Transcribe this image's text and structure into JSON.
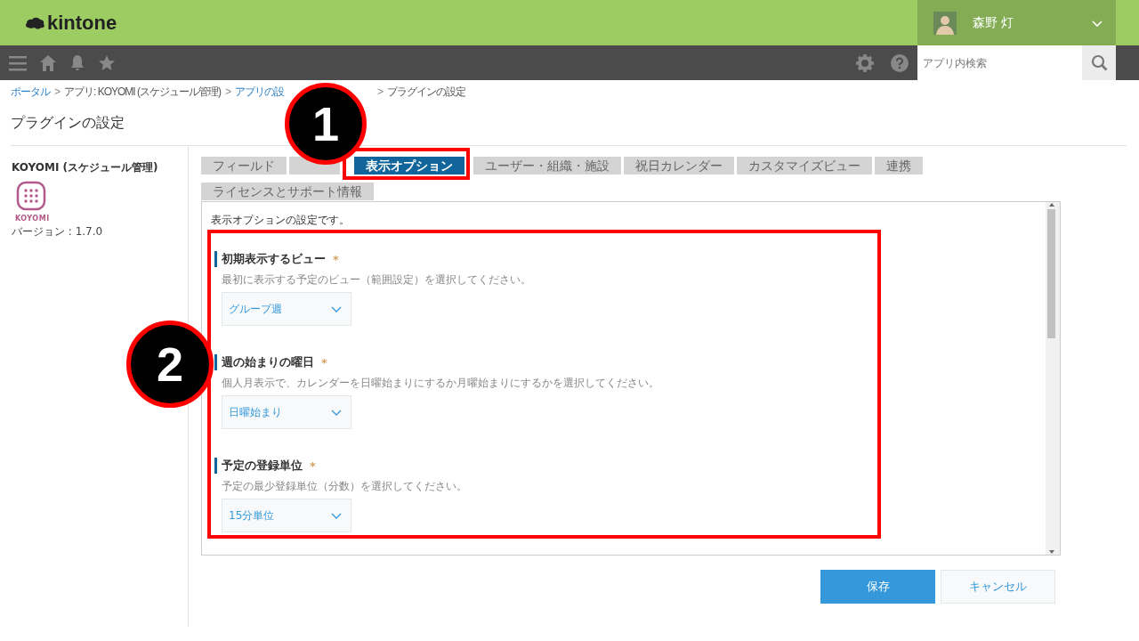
{
  "header": {
    "logo": "kintone",
    "user": {
      "name": "森野 灯"
    }
  },
  "navbar": {
    "search": {
      "placeholder": "アプリ内検索"
    }
  },
  "breadcrumb": [
    {
      "label": "ポータル",
      "kind": "link"
    },
    {
      "label": ">",
      "kind": "separator"
    },
    {
      "label": "アプリ: KOYOMI (スケジュール管理)",
      "kind": "text"
    },
    {
      "label": ">",
      "kind": "separator"
    },
    {
      "label": "アプリの設",
      "kind": "link"
    },
    {
      "label": ">",
      "kind": "separator"
    },
    {
      "label": "プラグインの設定",
      "kind": "text"
    }
  ],
  "page_title": "プラグインの設定",
  "plugin": {
    "name": "KOYOMI (スケジュール管理)",
    "icon_label": "KOYOMI",
    "version": "バージョン : 1.7.0"
  },
  "tabs": [
    {
      "label": "フィールド",
      "selected": false
    },
    {
      "selected": false
    },
    {
      "label": "表示オプション",
      "selected": true
    },
    {
      "label": "ユーザー・組織・施設",
      "selected": false
    },
    {
      "label": "祝日カレンダー",
      "selected": false
    },
    {
      "label": "カスタマイズビュー",
      "selected": false
    },
    {
      "label": "連携",
      "selected": false
    },
    {
      "label": "ライセンスとサポート情報",
      "selected": false
    }
  ],
  "panel": {
    "description": "表示オプションの設定です。",
    "options": [
      {
        "label": "初期表示するビュー",
        "required_mark": "*",
        "hint": "最初に表示する予定のビュー（範囲設定）を選択してください。",
        "value": "グループ週"
      },
      {
        "label": "週の始まりの曜日",
        "required_mark": "*",
        "hint": "個人月表示で、カレンダーを日曜始まりにするか月曜始まりにするかを選択してください。",
        "value": "日曜始まり"
      },
      {
        "label": "予定の登録単位",
        "required_mark": "*",
        "hint": "予定の最少登録単位（分数）を選択してください。",
        "value": "15分単位"
      }
    ]
  },
  "buttons": [
    {
      "label": "保存",
      "kind": "primary"
    },
    {
      "label": "キャンセル",
      "kind": "secondary"
    }
  ],
  "annotations": [
    {
      "number": "1"
    },
    {
      "number": "2"
    }
  ]
}
